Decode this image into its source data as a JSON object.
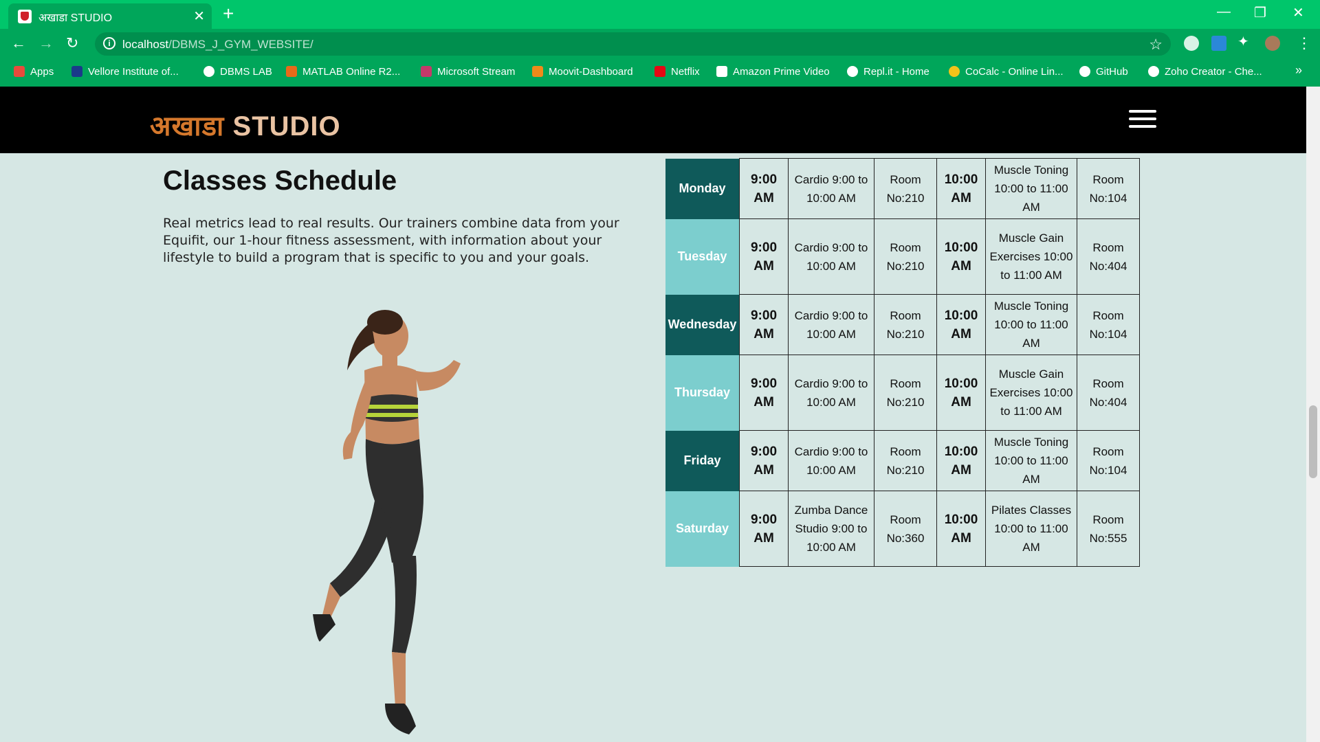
{
  "browser": {
    "tab_title": "अखाडा STUDIO",
    "tab_close": "✕",
    "new_tab": "+",
    "url_host": "localhost",
    "url_path": "/DBMS_J_GYM_WEBSITE/",
    "minimize": "—",
    "maximize": "❐",
    "close": "✕",
    "bookmarks": [
      "Apps",
      "Vellore Institute of...",
      "DBMS LAB",
      "MATLAB Online R2...",
      "Microsoft Stream",
      "Moovit-Dashboard",
      "Netflix",
      "Amazon Prime Video",
      "Repl.it - Home",
      "CoCalc - Online Lin...",
      "GitHub",
      "Zoho Creator - Che..."
    ],
    "bookmarks_more": "»"
  },
  "site": {
    "logo_hi": "अखाडा",
    "logo_en": "STUDIO"
  },
  "section": {
    "title": "Classes Schedule",
    "description": "Real metrics lead to real results. Our trainers combine data from your Equifit, our 1-hour fitness assessment, with information about your lifestyle to build a program that is specific to you and your goals."
  },
  "schedule": [
    {
      "day": "Monday",
      "time1": "9:00 AM",
      "class1": "Cardio 9:00 to 10:00 AM",
      "room1": "Room No:210",
      "time2": "10:00 AM",
      "class2": "Muscle Toning 10:00 to 11:00 AM",
      "room2": "Room No:104"
    },
    {
      "day": "Tuesday",
      "time1": "9:00 AM",
      "class1": "Cardio 9:00 to 10:00 AM",
      "room1": "Room No:210",
      "time2": "10:00 AM",
      "class2": "Muscle Gain Exercises 10:00 to 11:00 AM",
      "room2": "Room No:404"
    },
    {
      "day": "Wednesday",
      "time1": "9:00 AM",
      "class1": "Cardio 9:00 to 10:00 AM",
      "room1": "Room No:210",
      "time2": "10:00 AM",
      "class2": "Muscle Toning 10:00 to 11:00 AM",
      "room2": "Room No:104"
    },
    {
      "day": "Thursday",
      "time1": "9:00 AM",
      "class1": "Cardio 9:00 to 10:00 AM",
      "room1": "Room No:210",
      "time2": "10:00 AM",
      "class2": "Muscle Gain Exercises 10:00 to 11:00 AM",
      "room2": "Room No:404"
    },
    {
      "day": "Friday",
      "time1": "9:00 AM",
      "class1": "Cardio 9:00 to 10:00 AM",
      "room1": "Room No:210",
      "time2": "10:00 AM",
      "class2": "Muscle Toning 10:00 to 11:00 AM",
      "room2": "Room No:104"
    },
    {
      "day": "Saturday",
      "time1": "9:00 AM",
      "class1": "Zumba Dance Studio 9:00 to 10:00 AM",
      "room1": "Room No:360",
      "time2": "10:00 AM",
      "class2": "Pilates Classes 10:00 to 11:00 AM",
      "room2": "Room No:555"
    }
  ],
  "colors": {
    "chrome_green": "#00c66b",
    "toolbar_green": "#00a65a",
    "page_bg": "#d6e7e4",
    "day_dark": "#0f5a5a",
    "day_light": "#7ccece",
    "logo_orange": "#d5782c"
  },
  "icons": {
    "back": "arrow-left",
    "forward": "arrow-right",
    "reload": "reload",
    "bookmark_star": "star",
    "menu": "hamburger"
  }
}
